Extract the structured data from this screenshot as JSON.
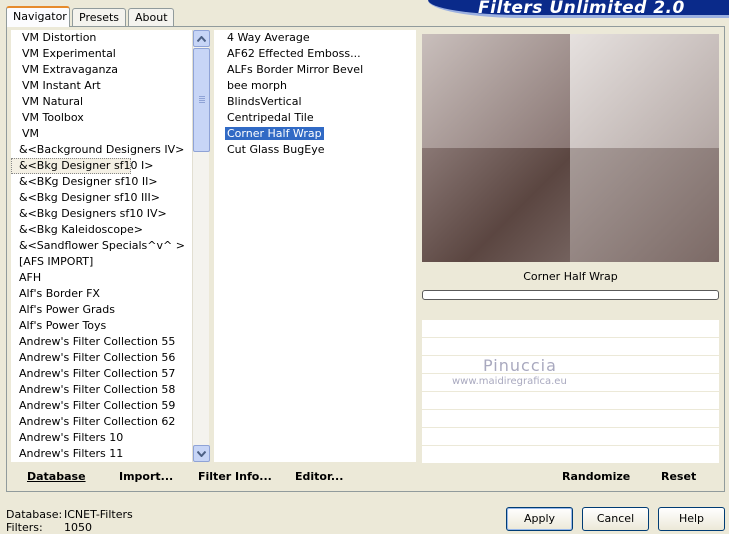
{
  "tabs": [
    "Navigator",
    "Presets",
    "About"
  ],
  "banner_title": "Filters Unlimited 2.0",
  "categories": [
    "VM Distortion",
    "VM Experimental",
    "VM Extravaganza",
    "VM Instant Art",
    "VM Natural",
    "VM Toolbox",
    "VM",
    "&<Background Designers IV>",
    "&<Bkg Designer sf10 I>",
    "&<BKg Designer sf10 II>",
    "&<Bkg Designer sf10 III>",
    "&<Bkg Designers sf10 IV>",
    "&<Bkg Kaleidoscope>",
    "&<Sandflower Specials^v^ >",
    "[AFS IMPORT]",
    "AFH",
    "Alf's Border FX",
    "Alf's Power Grads",
    "Alf's Power Toys",
    "Andrew's Filter Collection 55",
    "Andrew's Filter Collection 56",
    "Andrew's Filter Collection 57",
    "Andrew's Filter Collection 58",
    "Andrew's Filter Collection 59",
    "Andrew's Filter Collection 62",
    "Andrew's Filters 10",
    "Andrew's Filters 11"
  ],
  "selected_category": "&<Bkg Designer sf10 I>",
  "filters": [
    "4 Way Average",
    "AF62 Effected Emboss...",
    "ALFs Border Mirror Bevel",
    "bee morph",
    "BlindsVertical",
    "Centripedal Tile",
    "Corner Half Wrap",
    "Cut Glass  BugEye"
  ],
  "selected_filter": "Corner Half Wrap",
  "preview": {
    "filter_name": "Corner Half Wrap",
    "watermark_name": "Pinuccia",
    "watermark_url": "www.maidiregrafica.eu"
  },
  "buttons": {
    "database": "Database",
    "import": "Import...",
    "filter_info": "Filter Info...",
    "editor": "Editor...",
    "randomize": "Randomize",
    "reset": "Reset",
    "apply": "Apply",
    "cancel": "Cancel",
    "help": "Help"
  },
  "footer": {
    "database_label": "Database:",
    "database_value": "ICNET-Filters",
    "filters_label": "Filters:",
    "filters_value": "1050"
  }
}
